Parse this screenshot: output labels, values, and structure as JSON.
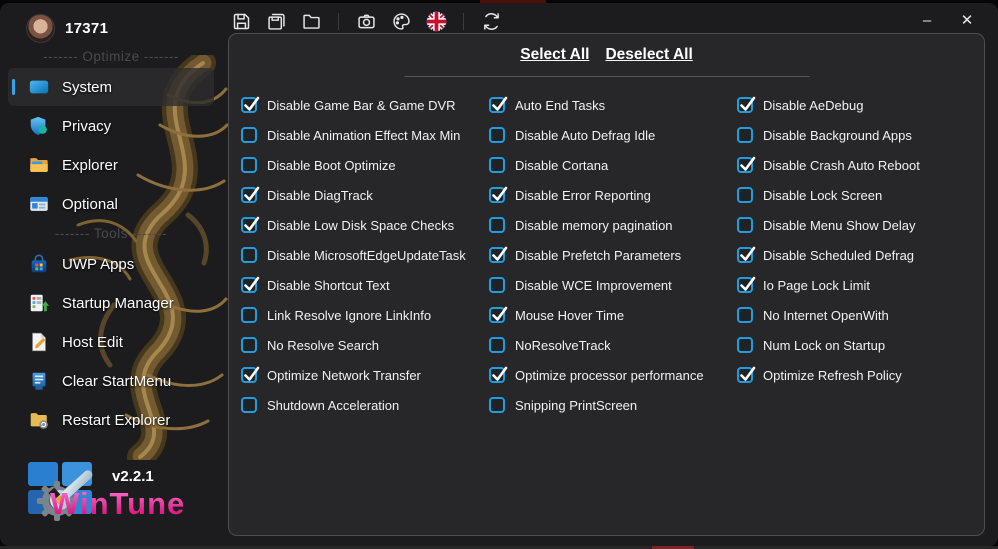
{
  "titlebar": {
    "user_name": "17371",
    "toolbar": [
      {
        "icon": "save-icon",
        "button": "save-button"
      },
      {
        "icon": "save-all-icon",
        "button": "save-all-button"
      },
      {
        "icon": "open-folder-icon",
        "button": "open-file-button"
      },
      {
        "type": "separator"
      },
      {
        "icon": "camera-icon",
        "button": "screenshot-button"
      },
      {
        "icon": "palette-icon",
        "button": "theme-button"
      },
      {
        "icon": "uk-flag-icon",
        "button": "language-button"
      },
      {
        "type": "separator"
      },
      {
        "icon": "refresh-icon",
        "button": "refresh-button"
      }
    ],
    "window_controls": {
      "minimize": "–",
      "close": "✕"
    }
  },
  "sidebar": {
    "sections": [
      {
        "separator": "------- Optimize -------",
        "items": [
          {
            "label": "System",
            "icon": "system-icon",
            "selected": true
          },
          {
            "label": "Privacy",
            "icon": "privacy-shield-icon",
            "selected": false
          },
          {
            "label": "Explorer",
            "icon": "explorer-folder-icon",
            "selected": false
          },
          {
            "label": "Optional",
            "icon": "optional-settings-icon",
            "selected": false
          }
        ]
      },
      {
        "separator": "------- Tools -------",
        "items": [
          {
            "label": "UWP Apps",
            "icon": "uwp-apps-bag-icon",
            "selected": false
          },
          {
            "label": "Startup Manager",
            "icon": "startup-manager-icon",
            "selected": false
          },
          {
            "label": "Host Edit",
            "icon": "host-edit-icon",
            "selected": false
          },
          {
            "label": "Clear StartMenu",
            "icon": "clear-startmenu-icon",
            "selected": false
          },
          {
            "label": "Restart Explorer",
            "icon": "restart-explorer-icon",
            "selected": false
          }
        ]
      }
    ],
    "footer": {
      "version": "v2.2.1",
      "brand": "WinTune"
    }
  },
  "main": {
    "select_all_label": "Select All",
    "deselect_all_label": "Deselect All",
    "columns": [
      [
        {
          "label": "Disable Game Bar & Game DVR",
          "checked": true
        },
        {
          "label": "Disable Animation Effect Max Min",
          "checked": false
        },
        {
          "label": "Disable Boot Optimize",
          "checked": false
        },
        {
          "label": "Disable DiagTrack",
          "checked": true
        },
        {
          "label": "Disable Low Disk Space Checks",
          "checked": true
        },
        {
          "label": "Disable MicrosoftEdgeUpdateTask",
          "checked": false
        },
        {
          "label": "Disable Shortcut Text",
          "checked": true
        },
        {
          "label": "Link Resolve Ignore LinkInfo",
          "checked": false
        },
        {
          "label": "No Resolve Search",
          "checked": false
        },
        {
          "label": "Optimize Network Transfer",
          "checked": true
        },
        {
          "label": "Shutdown Acceleration",
          "checked": false
        }
      ],
      [
        {
          "label": "Auto End Tasks",
          "checked": true
        },
        {
          "label": "Disable Auto Defrag Idle",
          "checked": false
        },
        {
          "label": "Disable Cortana",
          "checked": false
        },
        {
          "label": "Disable Error Reporting",
          "checked": true
        },
        {
          "label": "Disable memory pagination",
          "checked": false
        },
        {
          "label": "Disable Prefetch Parameters",
          "checked": true
        },
        {
          "label": "Disable WCE Improvement",
          "checked": false
        },
        {
          "label": "Mouse Hover Time",
          "checked": true
        },
        {
          "label": "NoResolveTrack",
          "checked": false
        },
        {
          "label": "Optimize processor performance",
          "checked": true
        },
        {
          "label": "Snipping PrintScreen",
          "checked": false
        }
      ],
      [
        {
          "label": "Disable AeDebug",
          "checked": true
        },
        {
          "label": "Disable Background Apps",
          "checked": false
        },
        {
          "label": "Disable Crash Auto Reboot",
          "checked": true
        },
        {
          "label": "Disable Lock Screen",
          "checked": false
        },
        {
          "label": "Disable Menu Show Delay",
          "checked": false
        },
        {
          "label": "Disable Scheduled Defrag",
          "checked": true
        },
        {
          "label": "Io Page Lock Limit",
          "checked": true
        },
        {
          "label": "No Internet OpenWith",
          "checked": false
        },
        {
          "label": "Num Lock on Startup",
          "checked": false
        },
        {
          "label": "Optimize Refresh Policy",
          "checked": true
        }
      ]
    ]
  },
  "colors": {
    "accent_blue": "#1f9ddf",
    "brand_magenta": "#e0218a",
    "dragon_gold": "#8d6d3a",
    "panel_bg": "#272729",
    "window_bg": "#1c1c1e"
  }
}
